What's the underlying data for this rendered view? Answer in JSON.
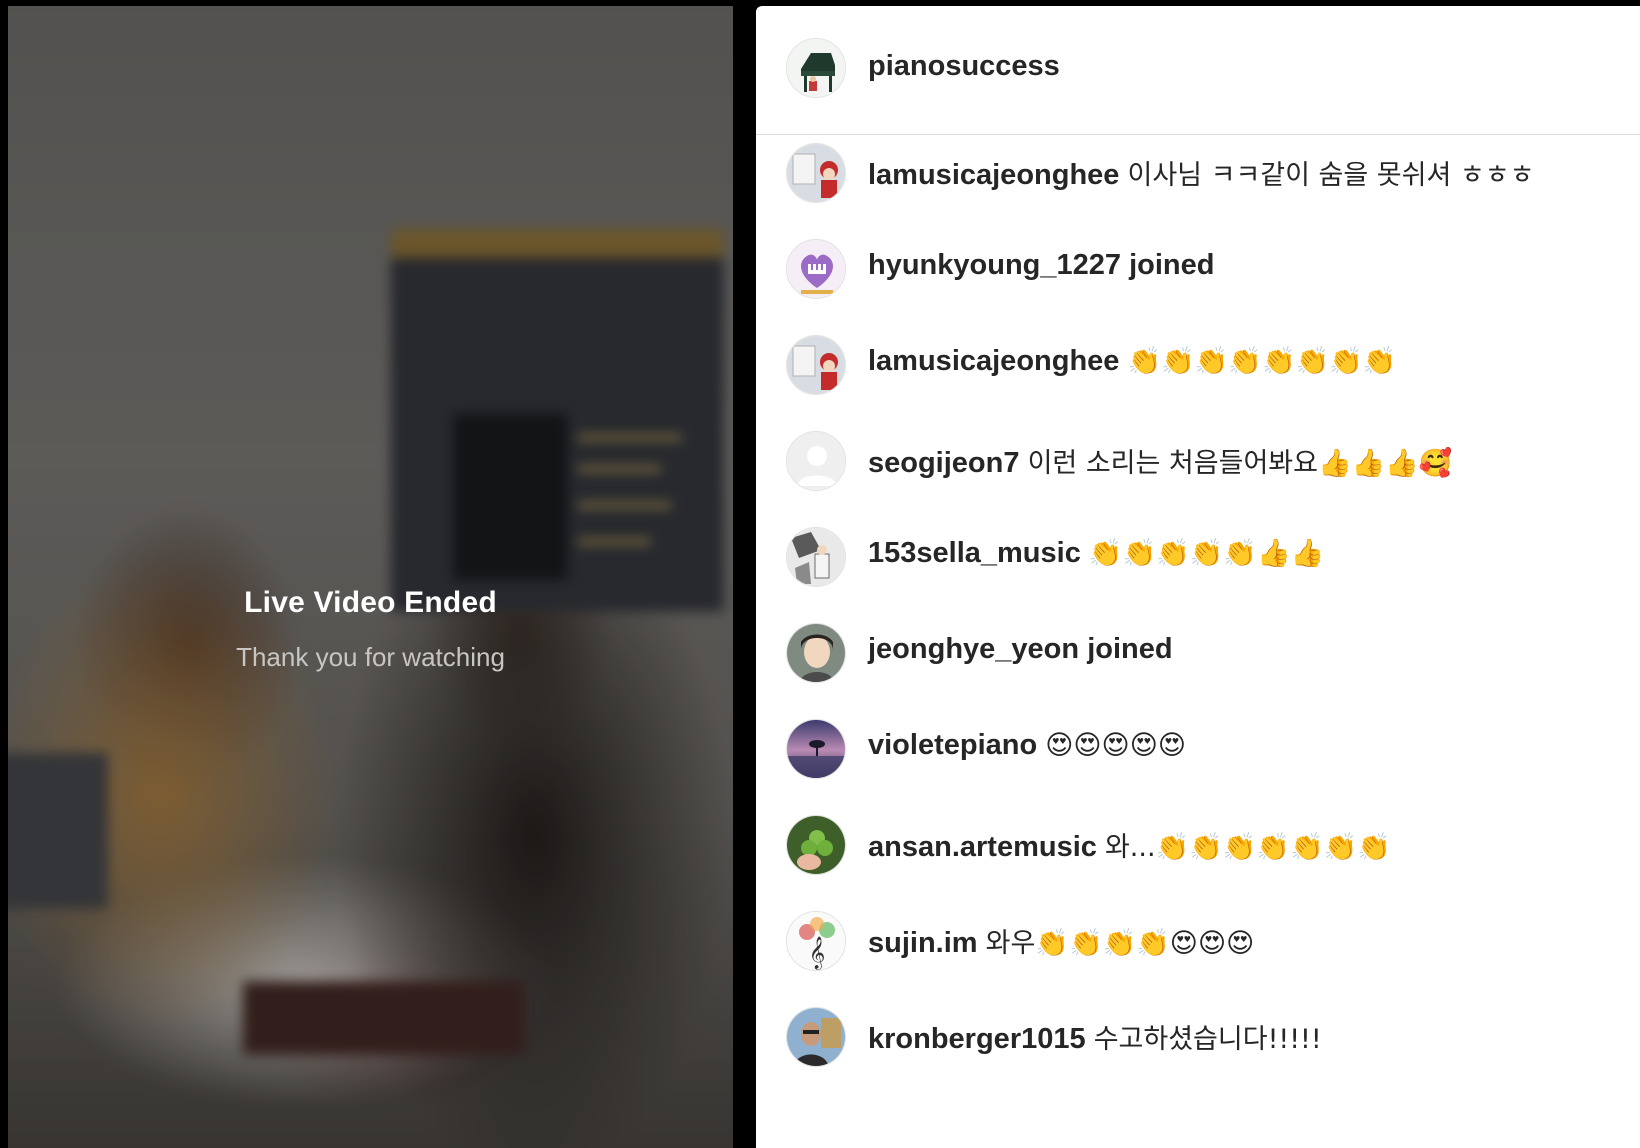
{
  "video": {
    "status_title": "Live Video Ended",
    "status_subtitle": "Thank you for watching"
  },
  "header": {
    "username": "pianosuccess",
    "avatar_icon": "grand-piano-avatar"
  },
  "comments": [
    {
      "username": "lamusicajeonghee",
      "text": "이사님 ㅋㅋ같이 숨을 못쉬셔 ㅎㅎㅎ",
      "avatar_icon": "doll-avatar",
      "type": "comment"
    },
    {
      "username": "hyunkyoung_1227",
      "text": "joined",
      "avatar_icon": "purple-piano-logo-avatar",
      "type": "joined"
    },
    {
      "username": "lamusicajeonghee",
      "text": "👏👏👏👏👏👏👏👏",
      "avatar_icon": "doll-avatar",
      "type": "comment"
    },
    {
      "username": "seogijeon7",
      "text": "이런 소리는 처음들어봐요👍👍👍🥰",
      "avatar_icon": "default-user-avatar",
      "type": "comment"
    },
    {
      "username": "153sella_music",
      "text": "👏👏👏👏👏👍👍",
      "avatar_icon": "illustration-avatar",
      "type": "comment"
    },
    {
      "username": "jeonghye_yeon",
      "text": "joined",
      "avatar_icon": "portrait-avatar",
      "type": "joined"
    },
    {
      "username": "violetepiano",
      "text": "😍😍😍😍😍",
      "avatar_icon": "sunset-tree-avatar",
      "type": "comment"
    },
    {
      "username": "ansan.artemusic",
      "text": "와...👏👏👏👏👏👏👏",
      "avatar_icon": "clover-avatar",
      "type": "comment"
    },
    {
      "username": "sujin.im",
      "text": "와우👏👏👏👏😍😍😍",
      "avatar_icon": "treble-clef-tree-avatar",
      "type": "comment"
    },
    {
      "username": "kronberger1015",
      "text": "수고하셨습니다!!!!!",
      "avatar_icon": "man-portrait-avatar",
      "type": "comment"
    }
  ],
  "colors": {
    "text": "#262626",
    "divider": "#dbdbdb",
    "background": "#ffffff",
    "video_text": "#ffffff"
  }
}
